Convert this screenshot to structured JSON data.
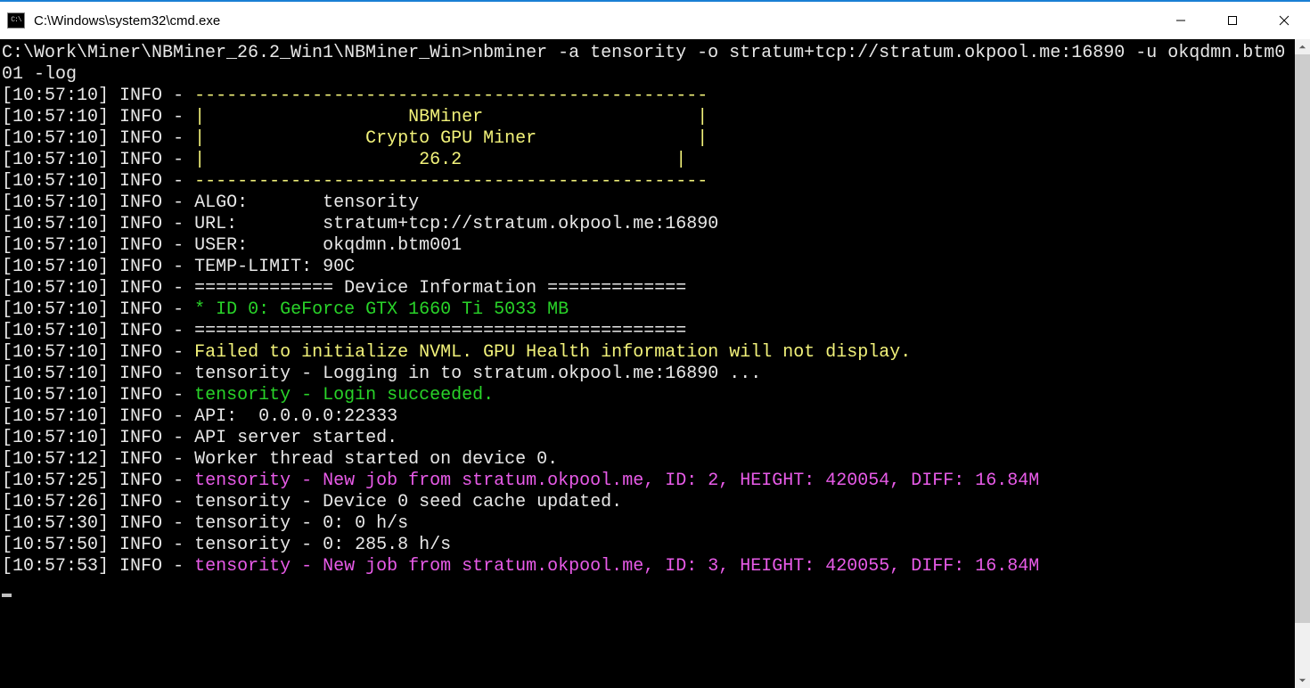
{
  "window": {
    "title": "C:\\Windows\\system32\\cmd.exe",
    "icon_label": "cmd-icon"
  },
  "terminal": {
    "prompt_line1": "C:\\Work\\Miner\\NBMiner_26.2_Win1\\NBMiner_Win>nbminer -a tensority -o stratum+tcp://stratum.okpool.me:16890 -u okqdmn.btm0",
    "prompt_line2": "01 -log",
    "ts": "[10:57:10]",
    "level": "INFO",
    "dash": "-",
    "border_top": "------------------------------------------------",
    "border_side_l": "|",
    "border_side_r": "|",
    "banner_pad_l": "                   ",
    "banner_pad_l2": "               ",
    "banner_pad_l3": "                    ",
    "banner_name": "NBMiner",
    "banner_desc": "Crypto GPU Miner",
    "banner_ver": "26.2",
    "banner_pad_r": "                    ",
    "banner_pad_r2": "               ",
    "banner_pad_r3": "                   ",
    "border_bot": "------------------------------------------------",
    "algo_label": "ALGO:       ",
    "algo_value": "tensority",
    "url_label": "URL:        ",
    "url_value": "stratum+tcp://stratum.okpool.me:16890",
    "user_label": "USER:       ",
    "user_value": "okqdmn.btm001",
    "temp_label": "TEMP-LIMIT: ",
    "temp_value": "90C",
    "devinfo_sep": "============= Device Information =============",
    "gpu_line": "* ID 0: GeForce GTX 1660 Ti 5033 MB",
    "eq_sep": "==============================================",
    "nvml_fail": "Failed to initialize NVML. GPU Health information will not display.",
    "login_line": "tensority - Logging in to stratum.okpool.me:16890 ...",
    "login_ok": "tensority - Login succeeded.",
    "api_line": "API:  0.0.0.0:22333",
    "api_started": "API server started.",
    "ts12": "[10:57:12]",
    "worker_line": "Worker thread started on device 0.",
    "ts25": "[10:57:25]",
    "job2": "tensority - New job from stratum.okpool.me, ID: 2, HEIGHT: 420054, DIFF: 16.84M",
    "ts26": "[10:57:26]",
    "seed_line": "tensority - Device 0 seed cache updated.",
    "ts30": "[10:57:30]",
    "hash0": "tensority - 0: 0 h/s",
    "ts50": "[10:57:50]",
    "hash1": "tensority - 0: 285.8 h/s",
    "ts53": "[10:57:53]",
    "job3": "tensority - New job from stratum.okpool.me, ID: 3, HEIGHT: 420055, DIFF: 16.84M"
  }
}
